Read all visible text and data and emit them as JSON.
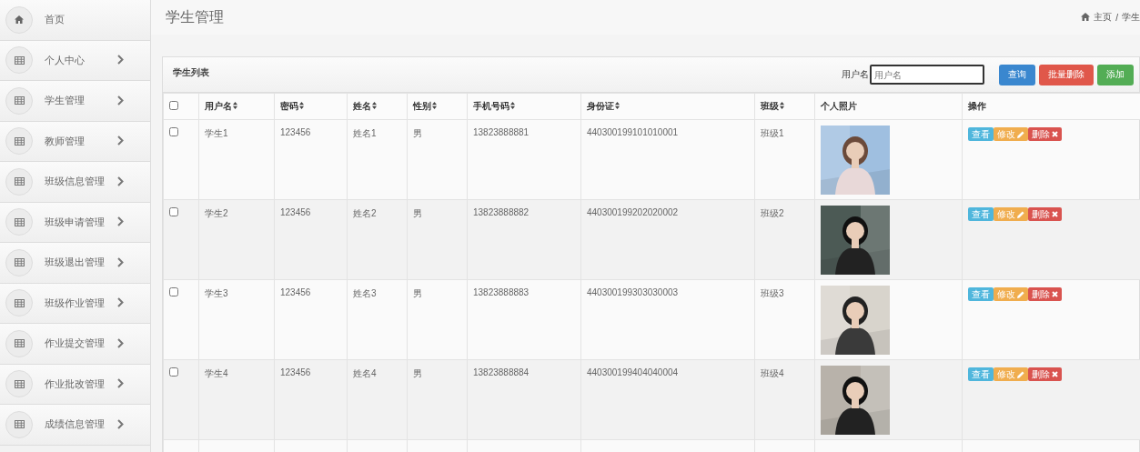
{
  "sidebar": {
    "items": [
      {
        "label": "首页",
        "kind": "home"
      },
      {
        "label": "个人中心",
        "kind": "menu"
      },
      {
        "label": "学生管理",
        "kind": "menu"
      },
      {
        "label": "教师管理",
        "kind": "menu"
      },
      {
        "label": "班级信息管理",
        "kind": "menu"
      },
      {
        "label": "班级申请管理",
        "kind": "menu"
      },
      {
        "label": "班级退出管理",
        "kind": "menu"
      },
      {
        "label": "班级作业管理",
        "kind": "menu"
      },
      {
        "label": "作业提交管理",
        "kind": "menu"
      },
      {
        "label": "作业批改管理",
        "kind": "menu"
      },
      {
        "label": "成绩信息管理",
        "kind": "menu"
      }
    ]
  },
  "header": {
    "title": "学生管理",
    "breadcrumb": [
      "主页",
      "/",
      "学生"
    ]
  },
  "panel": {
    "title": "学生列表",
    "search": {
      "label": "用户名",
      "placeholder": "用户名"
    },
    "buttons": [
      {
        "label": "查询",
        "kind": "primary"
      },
      {
        "label": "批量删除",
        "kind": "danger"
      },
      {
        "label": "添加",
        "kind": "success"
      }
    ],
    "table": {
      "columns": [
        {
          "label": "用户名",
          "sortable": true
        },
        {
          "label": "密码",
          "sortable": true
        },
        {
          "label": "姓名",
          "sortable": true
        },
        {
          "label": "性别",
          "sortable": true
        },
        {
          "label": "手机号码",
          "sortable": true
        },
        {
          "label": "身份证",
          "sortable": true
        },
        {
          "label": "班级",
          "sortable": true
        },
        {
          "label": "个人照片",
          "sortable": false
        },
        {
          "label": "操作",
          "sortable": false
        }
      ],
      "select_all_checked": false,
      "rows": [
        {
          "checked": false,
          "cells": [
            "学生1",
            "123456",
            "姓名1",
            "男",
            "13823888881",
            "440300199101010001",
            "班级1"
          ],
          "photo": {
            "kind": "picture"
          },
          "actions": [
            {
              "label": "查看",
              "kind": "view"
            },
            {
              "label": "修改",
              "kind": "edit"
            },
            {
              "label": "删除",
              "kind": "delete"
            }
          ]
        },
        {
          "checked": false,
          "cells": [
            "学生2",
            "123456",
            "姓名2",
            "男",
            "13823888882",
            "440300199202020002",
            "班级2"
          ],
          "photo": {
            "kind": "picture"
          },
          "actions": [
            {
              "label": "查看",
              "kind": "view"
            },
            {
              "label": "修改",
              "kind": "edit"
            },
            {
              "label": "删除",
              "kind": "delete"
            }
          ]
        },
        {
          "checked": false,
          "cells": [
            "学生3",
            "123456",
            "姓名3",
            "男",
            "13823888883",
            "440300199303030003",
            "班级3"
          ],
          "photo": {
            "kind": "picture"
          },
          "actions": [
            {
              "label": "查看",
              "kind": "view"
            },
            {
              "label": "修改",
              "kind": "edit"
            },
            {
              "label": "删除",
              "kind": "delete"
            }
          ]
        },
        {
          "checked": false,
          "cells": [
            "学生4",
            "123456",
            "姓名4",
            "男",
            "13823888884",
            "440300199404040004",
            "班级4"
          ],
          "photo": {
            "kind": "picture"
          },
          "actions": [
            {
              "label": "查看",
              "kind": "view"
            },
            {
              "label": "修改",
              "kind": "edit"
            },
            {
              "label": "删除",
              "kind": "delete"
            }
          ]
        }
      ]
    }
  }
}
